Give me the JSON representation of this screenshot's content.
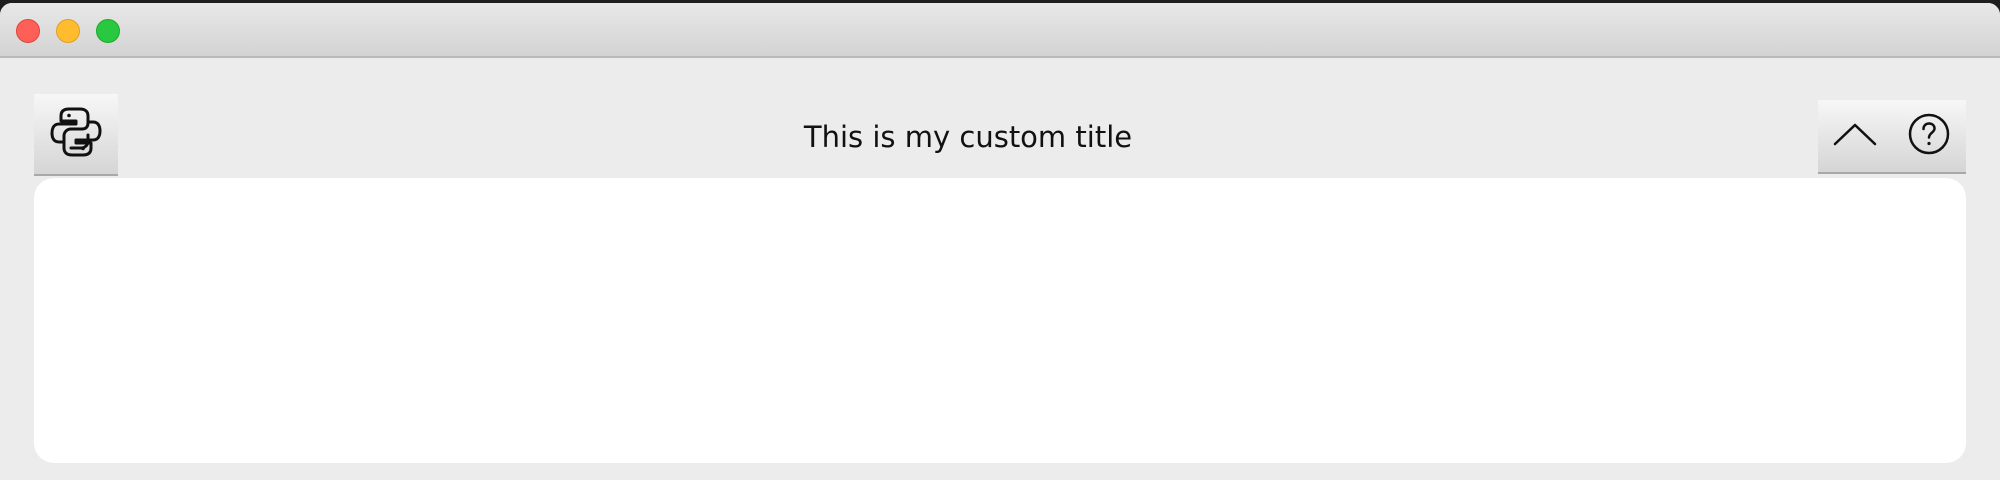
{
  "window": {
    "title": "This is my custom title",
    "controls": [
      "close",
      "minimize",
      "maximize"
    ]
  },
  "toolbar": {
    "left_icon": "python-logo-icon",
    "right_icons": [
      "chevron-up-icon",
      "help-icon"
    ]
  },
  "colors": {
    "window_bg": "#ececec",
    "content_bg": "#ffffff",
    "close": "#fe5f57",
    "minimize": "#febc2e",
    "maximize": "#28c840"
  }
}
